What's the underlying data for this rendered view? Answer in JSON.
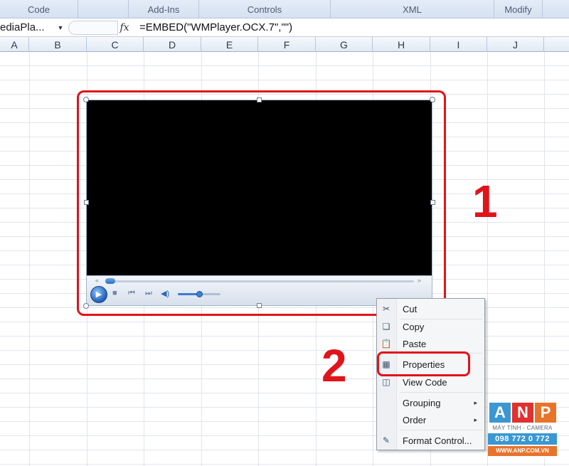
{
  "ribbon": {
    "groups": [
      {
        "label": "Code"
      },
      {
        "label": "Add-Ins"
      },
      {
        "label": "Controls"
      },
      {
        "label": "XML"
      },
      {
        "label": "Modify"
      }
    ]
  },
  "formula_bar": {
    "name_box": "ediaPla...",
    "fx_icon": "fx",
    "formula": "=EMBED(\"WMPlayer.OCX.7\",\"\")"
  },
  "columns": [
    "A",
    "B",
    "C",
    "D",
    "E",
    "F",
    "G",
    "H",
    "I",
    "J"
  ],
  "media_player": {
    "seek_back": "«",
    "seek_forward": "»",
    "play_icon": "▶",
    "stop_icon": "■",
    "prev_icon": "⏮",
    "next_icon": "⏭",
    "volume_icon": "◀)",
    "volume_level": 0.5
  },
  "annotations": {
    "step_1": "1",
    "step_2": "2"
  },
  "context_menu": {
    "items": [
      {
        "label": "Cut",
        "icon": "scissors-icon"
      },
      {
        "label": "Copy",
        "icon": "copy-icon"
      },
      {
        "label": "Paste",
        "icon": "paste-icon"
      },
      {
        "label": "Properties",
        "icon": "properties-icon"
      },
      {
        "label": "View Code",
        "icon": "view-code-icon"
      },
      {
        "label": "Grouping",
        "submenu": true
      },
      {
        "label": "Order",
        "submenu": true
      },
      {
        "label": "Format Control...",
        "icon": "format-control-icon"
      }
    ],
    "submenu_arrow": "▸"
  },
  "watermark": {
    "letters": [
      "A",
      "N",
      "P"
    ],
    "tagline": "MÁY TÍNH - CAMERA",
    "phone": "098 772 0 772",
    "website": "WWW.ANP.COM.VN",
    "colors": {
      "blue": "#3b97d3",
      "red": "#e0312f",
      "orange": "#e8742a"
    }
  },
  "colors": {
    "accent_red": "#e0141a",
    "player_black": "#000000"
  }
}
